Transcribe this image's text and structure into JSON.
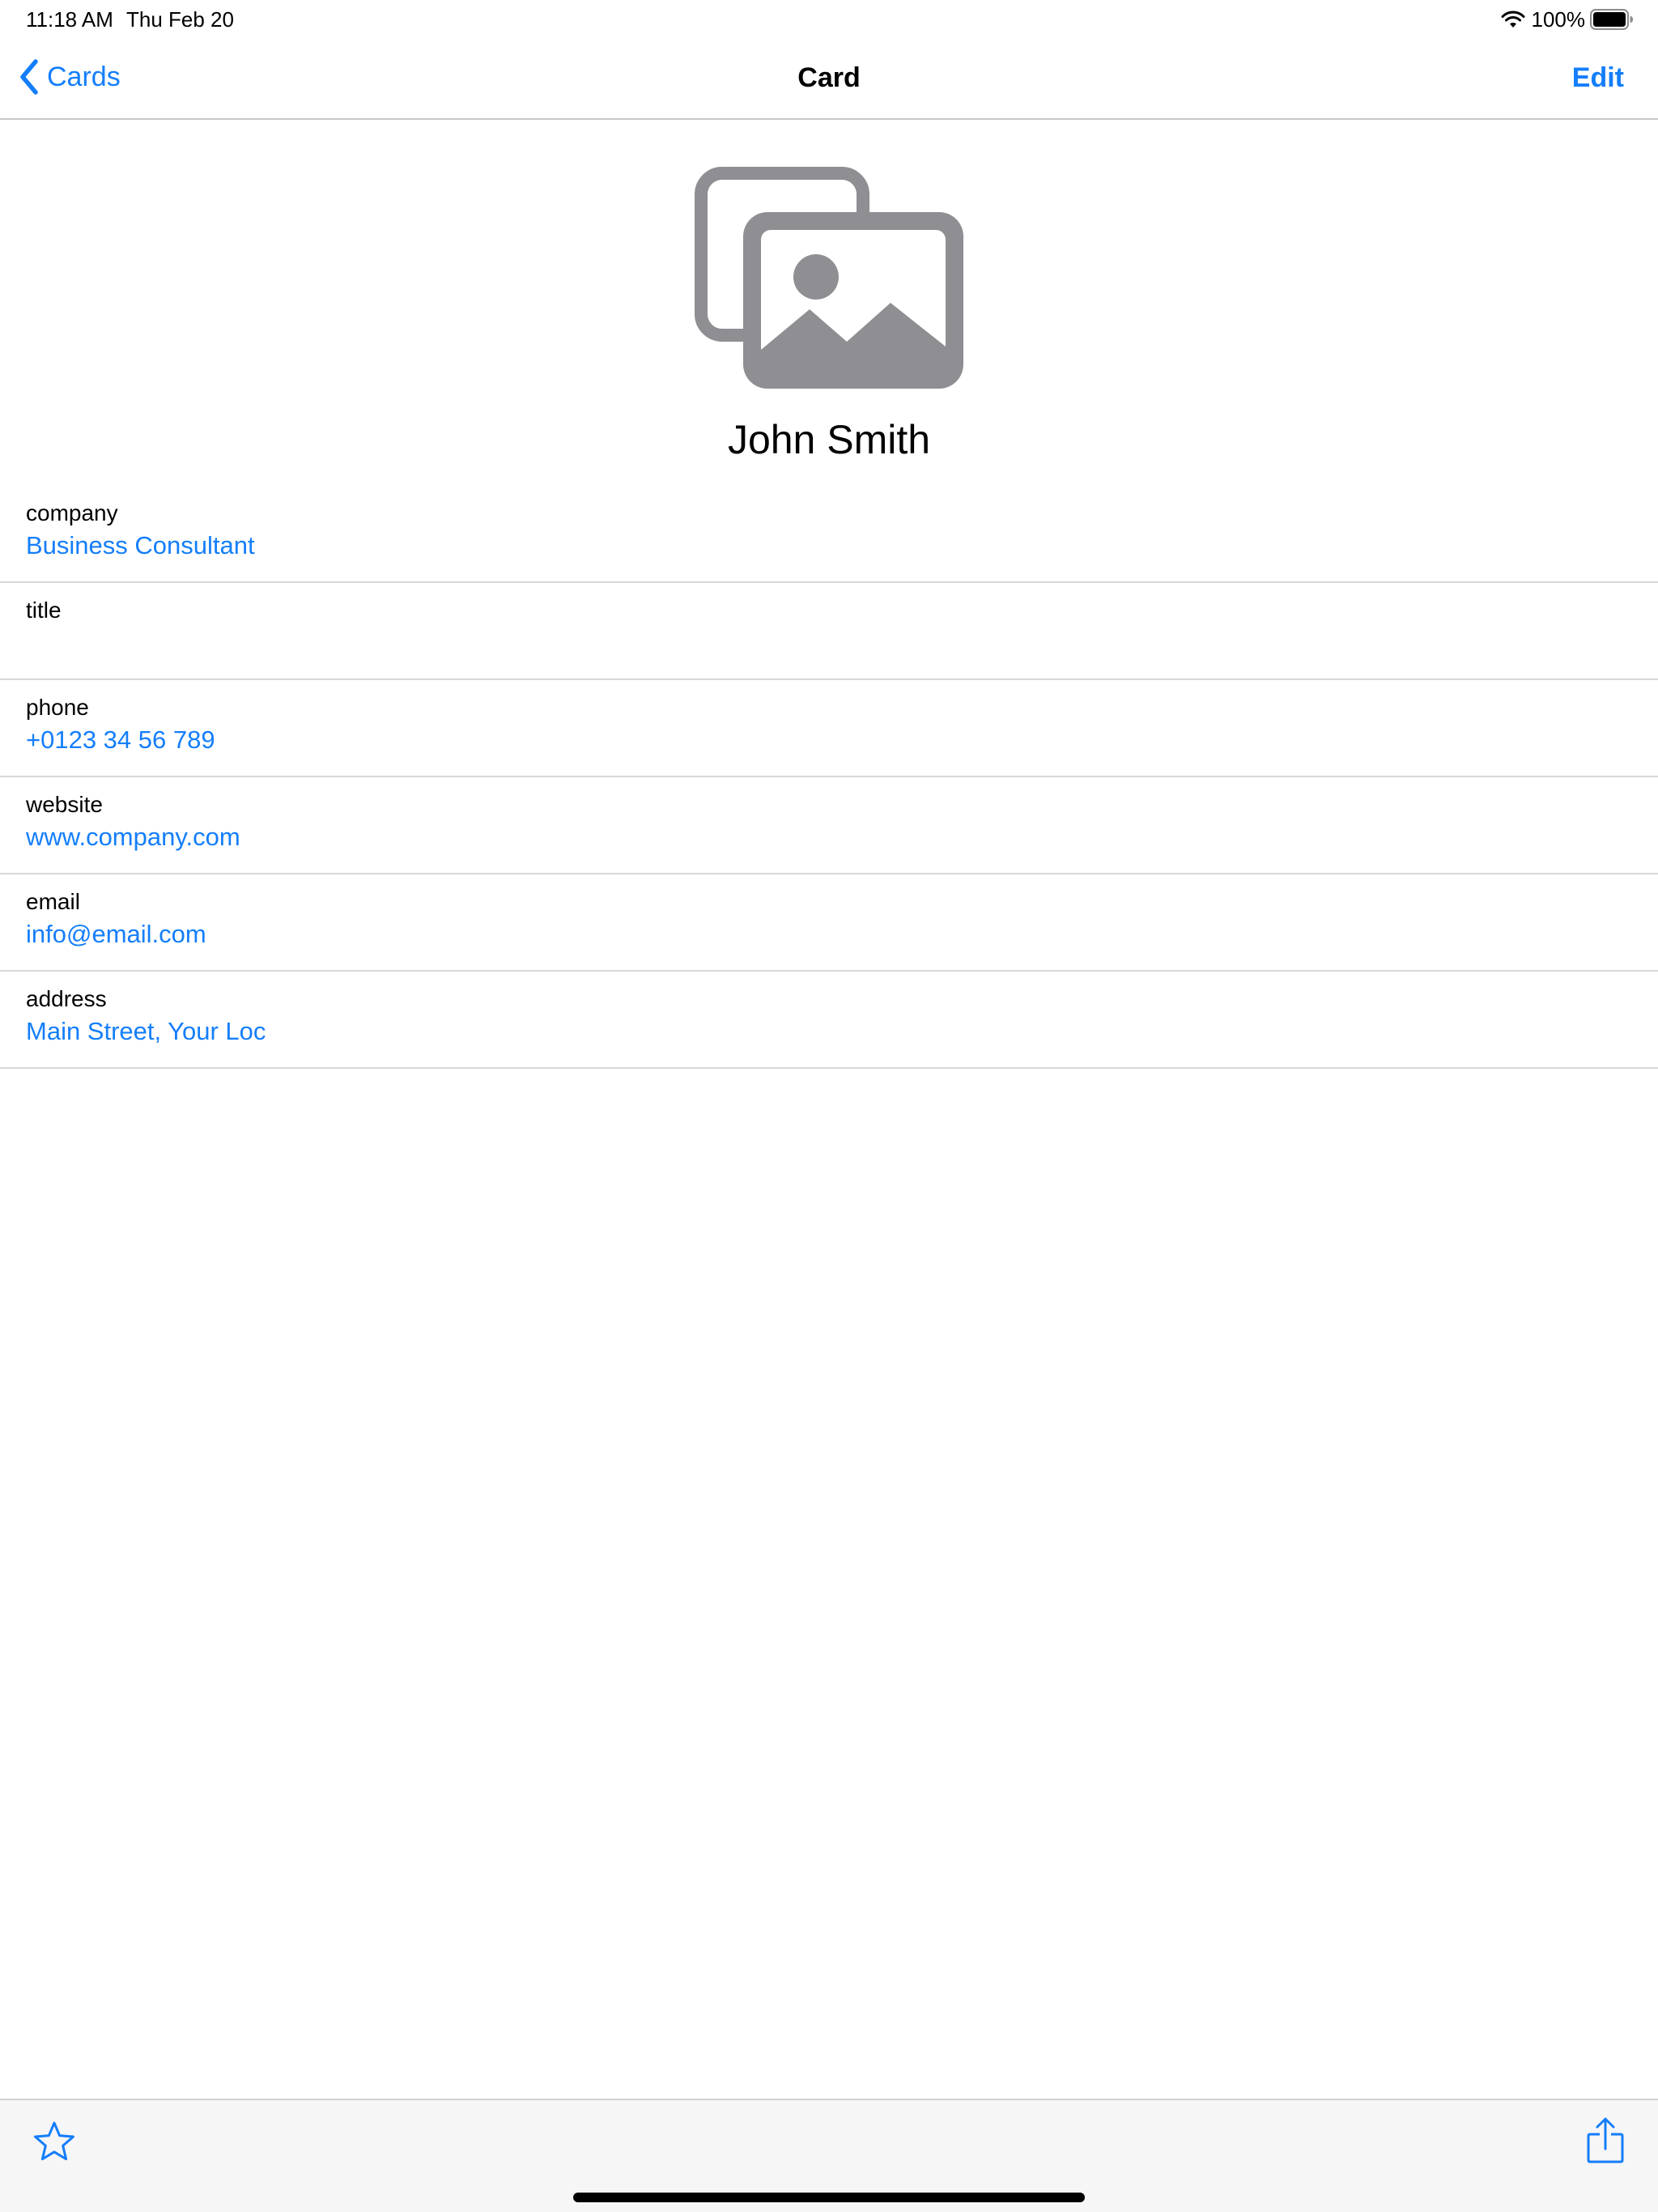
{
  "status_bar": {
    "time": "11:18 AM",
    "date": "Thu Feb 20",
    "battery": "100%",
    "wifi_icon": "wifi-icon",
    "battery_icon": "battery-full-icon"
  },
  "nav": {
    "back_label": "Cards",
    "title": "Card",
    "edit_label": "Edit"
  },
  "card": {
    "photo_icon": "photo-placeholder-icon",
    "name": "John Smith"
  },
  "fields": [
    {
      "label": "company",
      "value": "Business Consultant"
    },
    {
      "label": "title",
      "value": ""
    },
    {
      "label": "phone",
      "value": "+0123 34 56 789"
    },
    {
      "label": "website",
      "value": "www.company.com"
    },
    {
      "label": "email",
      "value": "info@email.com"
    },
    {
      "label": "address",
      "value": "Main Street, Your Loc"
    }
  ],
  "toolbar": {
    "favorite_icon": "star-icon",
    "share_icon": "share-icon"
  },
  "colors": {
    "accent": "#147efb",
    "separator": "#d8d8dc",
    "toolbar_bg": "#f6f6f7",
    "placeholder_icon": "#8e8e93"
  }
}
